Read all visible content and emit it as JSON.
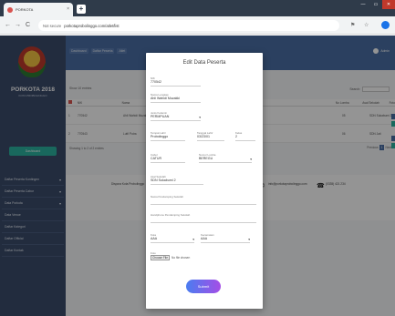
{
  "browser": {
    "tab_title": "PORKOTA",
    "tab_close": "×",
    "new_tab": "+",
    "win_min": "—",
    "win_max": "▭",
    "win_close": "✕",
    "back": "←",
    "forward": "→",
    "reload": "C",
    "security": "Not secure",
    "url": "porkotaprobolinggo.com/atlet/list",
    "ext1": "⚑",
    "ext2": "☆"
  },
  "sidebar": {
    "brand": "PORKOTA 2018",
    "brand_sub": "KOTA PROBOLINGGO",
    "dashboard": "Dashboard",
    "items": [
      {
        "label": "Daftar Peserta Kontingen"
      },
      {
        "label": "Daftar Peserta Cabor"
      },
      {
        "label": "Data Porkota"
      },
      {
        "label": "Data Venue"
      },
      {
        "label": "Daftar Kategori"
      },
      {
        "label": "Daftar Official"
      },
      {
        "label": "Daftar Kontak"
      }
    ]
  },
  "topbar": {
    "crumbs": [
      "Dashboard",
      "Daftar Peserta",
      "Atlet"
    ],
    "user": "Admin"
  },
  "table": {
    "show": "Show 10 entries",
    "search_label": "Search:",
    "headers": [
      "No",
      "NIK",
      "Nama",
      "",
      "No Lomba",
      "Asal Sekolah",
      "Foto"
    ],
    "rows": [
      {
        "no": "1",
        "nik": "770542",
        "nama": "Ahli Wahidi Muzakki",
        "lomba": "05",
        "sekolah": "SDN Sukabumi 2"
      },
      {
        "no": "2",
        "nik": "770543",
        "nama": "Lutfi Putra",
        "lomba": "06",
        "sekolah": "SDN Jati"
      }
    ],
    "showing": "Showing 1 to 2 of 2 entries",
    "prev": "Previous",
    "page": "1",
    "next": "Next"
  },
  "footer": {
    "col1": "Dispora Kota Probolinggo",
    "col2": "info@porkotaprobolinggo.com",
    "col3": "(0335) 421 234",
    "phone_icon": "☎",
    "mail_icon": "✉"
  },
  "modal": {
    "title": "Edit Data Peserta",
    "fields": {
      "nik_label": "NIK",
      "nik_value": "770542",
      "nama_label": "Nama Lengkap",
      "nama_value": "Ahli Wahidi Muzakki",
      "jk_label": "Jenis Kelamin",
      "jk_value": "PERMPUAN",
      "tempat_label": "Tempat Lahir",
      "tempat_value": "Probolinggo",
      "tgl_label": "Tanggal Lahir",
      "tgl_value": "03/23/01",
      "kelas_label": "Kelas",
      "kelas_value": "2",
      "cabor_label": "Cabor",
      "cabor_value": "CATUR",
      "nomor_label": "Nomor Lomba",
      "nomor_value": "BEREGU",
      "sekolah_label": "Asal Sekolah",
      "sekolah_value": "SDN Sukabumi 2",
      "pendamping_label": "Nama Pendamping Sekolah",
      "pendamping_value": "",
      "hp_label": "Handphone Pendamping Sekolah",
      "hp_value": "",
      "kota_label": "Kota",
      "kota_value": "AAA",
      "kecamatan_label": "Kecamatan",
      "kecamatan_value": "AAA",
      "foto_label": "Foto",
      "file_btn": "Choose File",
      "file_text": "No file chosen"
    },
    "caret": "▾",
    "submit": "Submit"
  }
}
